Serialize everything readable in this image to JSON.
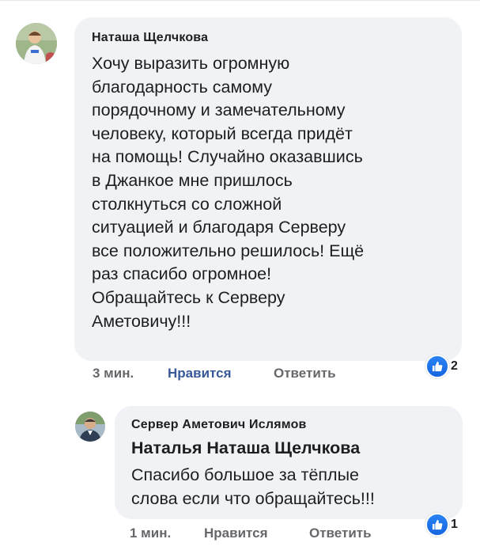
{
  "comments": [
    {
      "author": "Наташа Щелчкова",
      "lines": [
        "Хочу выразить огромную",
        "благодарность самому",
        "порядочному и замечательному",
        "человеку, который всегда придёт",
        "на помощь! Случайно оказавшись",
        "в Джанкое мне пришлось",
        "столкнуться со сложной",
        "ситуацией и благодаря Серверу",
        "все положительно решилось! Ещё",
        "раз спасибо огромное!",
        "Обращайтесь к Серверу",
        "Аметовичу!!!"
      ],
      "time": "3 мин.",
      "like_label": "Нравится",
      "reply_label": "Ответить",
      "reaction_count": "2",
      "reaction_icon": "thumbs-up-icon",
      "like_color": "#385898"
    },
    {
      "author": "Сервер Аметович Ислямов",
      "mention": "Наталья Наташа Щелчкова",
      "lines": [
        "Спасибо большое за тёплые",
        "слова если что обращайтесь!!!"
      ],
      "time": "1 мин.",
      "like_label": "Нравится",
      "reply_label": "Ответить",
      "reaction_count": "1",
      "reaction_icon": "thumbs-up-icon"
    }
  ],
  "colors": {
    "bubble": "#f0f2f5",
    "like_active": "#385898",
    "meta": "#65676b",
    "reaction_blue": "#1877f2"
  }
}
